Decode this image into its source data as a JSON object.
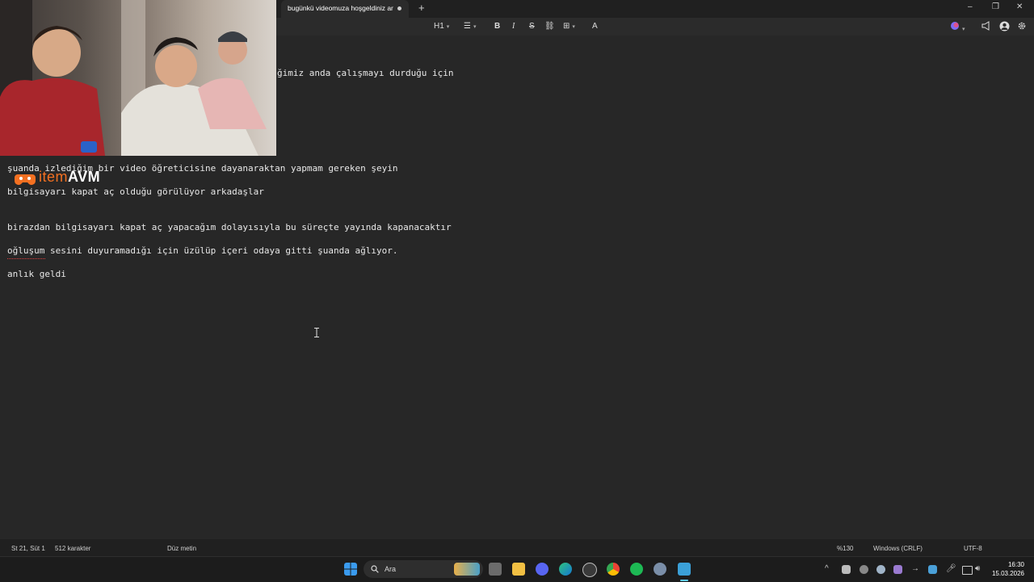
{
  "tab": {
    "title": "bugünkü videomuza hoşgeldiniz ar",
    "new_tab": "+"
  },
  "window_controls": {
    "minimize": "–",
    "restore": "❐",
    "close": "✕"
  },
  "toolbar": {
    "heading": "H1",
    "list": "☰",
    "bold": "B",
    "italic": "I",
    "strike": "S",
    "link": "⛓",
    "table": "⊞",
    "clear": "A"
  },
  "editor": {
    "lines": [
      "ğimiz anda çalışmayı durduğu için",
      "şuanda izlediğim bir video öğreticisine dayanaraktan yapmam gereken şeyin",
      "bilgisayarı kapat aç olduğu görülüyor arkadaşlar",
      "birazdan bilgisayarı kapat aç yapacağım dolayısıyla bu süreçte yayında kapanacaktır",
      "oğluşum sesini duyuramadığı için üzülüp içeri odaya gitti şuanda ağlıyor.",
      "anlık geldi"
    ]
  },
  "logo": {
    "part1": "item",
    "part2": "AVM"
  },
  "statusbar": {
    "position": "St 21, Süt 1",
    "chars": "512 karakter",
    "format": "Düz metin",
    "zoom": "%130",
    "line_ending": "Windows (CRLF)",
    "encoding": "UTF-8"
  },
  "taskbar": {
    "search_placeholder": "Ara",
    "time": "16:30",
    "date": "15.03.2026"
  },
  "colors": {
    "accent": "#0078d4",
    "logo_orange": "#f37021"
  }
}
